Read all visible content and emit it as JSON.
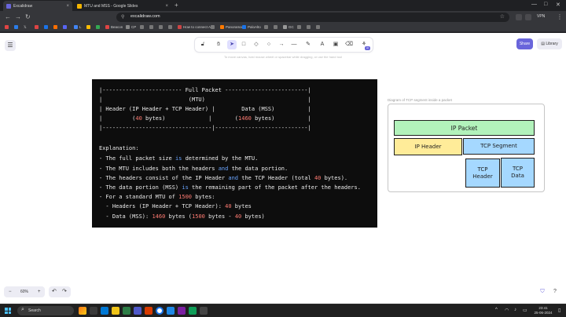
{
  "browser": {
    "tabs": [
      {
        "label": "Excalidraw",
        "color": "#6965db",
        "active": true
      },
      {
        "label": "MTU and MSS - Google Slides",
        "color": "#f4b400",
        "active": false
      }
    ],
    "url": "excalidraw.com",
    "vpn_label": "VPN",
    "bookmarks": [
      {
        "label": "L",
        "color": "#4285f4"
      },
      {
        "label": "Beacon",
        "color": "#e04444"
      },
      {
        "label": "CP",
        "color": "#888888"
      },
      {
        "label": "How to connect A...",
        "color": "#cc4444"
      },
      {
        "label": "Panorama",
        "color": "#ff7a00"
      },
      {
        "label": "PaloAlto",
        "color": "#1a73e8"
      },
      {
        "label": "GC",
        "color": "#999999"
      }
    ]
  },
  "excalidraw": {
    "hint": "To move canvas, hold mouse wheel or spacebar while dragging, or use the hand tool",
    "share_label": "Share",
    "library_label": "Library",
    "zoom_label": "60%",
    "zoom_out": "−",
    "zoom_in": "+",
    "tool_badge": "AI"
  },
  "codeblock": {
    "lines": [
      [
        {
          "t": "|------------------------ Full Packet -------------------------|"
        }
      ],
      [
        {
          "t": "|                          (MTU)                               |"
        }
      ],
      [
        {
          "t": "| Header (IP Header + TCP Header) |        Data (MSS)          |"
        }
      ],
      [
        {
          "t": "|         ("
        },
        {
          "t": "40",
          "c": "red"
        },
        {
          "t": " bytes)             |       ("
        },
        {
          "t": "1460",
          "c": "red"
        },
        {
          "t": " bytes)          |"
        }
      ],
      [
        {
          "t": "|---------------------------------|----------------------------|"
        }
      ],
      [
        {
          "t": ""
        }
      ],
      [
        {
          "t": "Explanation:"
        }
      ],
      [
        {
          "t": "- The full packet size "
        },
        {
          "t": "is",
          "c": "blue"
        },
        {
          "t": " determined by the MTU."
        }
      ],
      [
        {
          "t": "- The MTU includes both the headers "
        },
        {
          "t": "and",
          "c": "blue"
        },
        {
          "t": " the data portion."
        }
      ],
      [
        {
          "t": "- The headers consist of the IP Header "
        },
        {
          "t": "and",
          "c": "blue"
        },
        {
          "t": " the TCP Header (total "
        },
        {
          "t": "40",
          "c": "red"
        },
        {
          "t": " bytes)."
        }
      ],
      [
        {
          "t": "- The data portion (MSS) "
        },
        {
          "t": "is",
          "c": "blue"
        },
        {
          "t": " the remaining part of the packet after the headers."
        }
      ],
      [
        {
          "t": "- For a standard MTU of "
        },
        {
          "t": "1500",
          "c": "red"
        },
        {
          "t": " bytes:"
        }
      ],
      [
        {
          "t": "  - Headers (IP Header + TCP Header): "
        },
        {
          "t": "40",
          "c": "red"
        },
        {
          "t": " bytes"
        }
      ],
      [
        {
          "t": "  - Data (MSS): "
        },
        {
          "t": "1460",
          "c": "red"
        },
        {
          "t": " bytes ("
        },
        {
          "t": "1500",
          "c": "red"
        },
        {
          "t": " bytes - "
        },
        {
          "t": "40",
          "c": "red"
        },
        {
          "t": " bytes)"
        }
      ]
    ]
  },
  "diagram": {
    "caption": "Diagram of TCP segment inside a packet",
    "boxes": {
      "ip_packet": {
        "label": "IP Packet",
        "color": "#b2f2bb"
      },
      "ip_header": {
        "label": "IP Header",
        "color": "#ffec99"
      },
      "tcp_segment": {
        "label": "TCP Segment",
        "color": "#a5d8ff"
      },
      "tcp_header": {
        "label": "TCP Header",
        "color": "#a5d8ff"
      },
      "tcp_data": {
        "label": "TCP Data",
        "color": "#a5d8ff"
      }
    }
  },
  "taskbar": {
    "search_label": "Search",
    "time": "23:41",
    "date": "25-06-2024"
  }
}
